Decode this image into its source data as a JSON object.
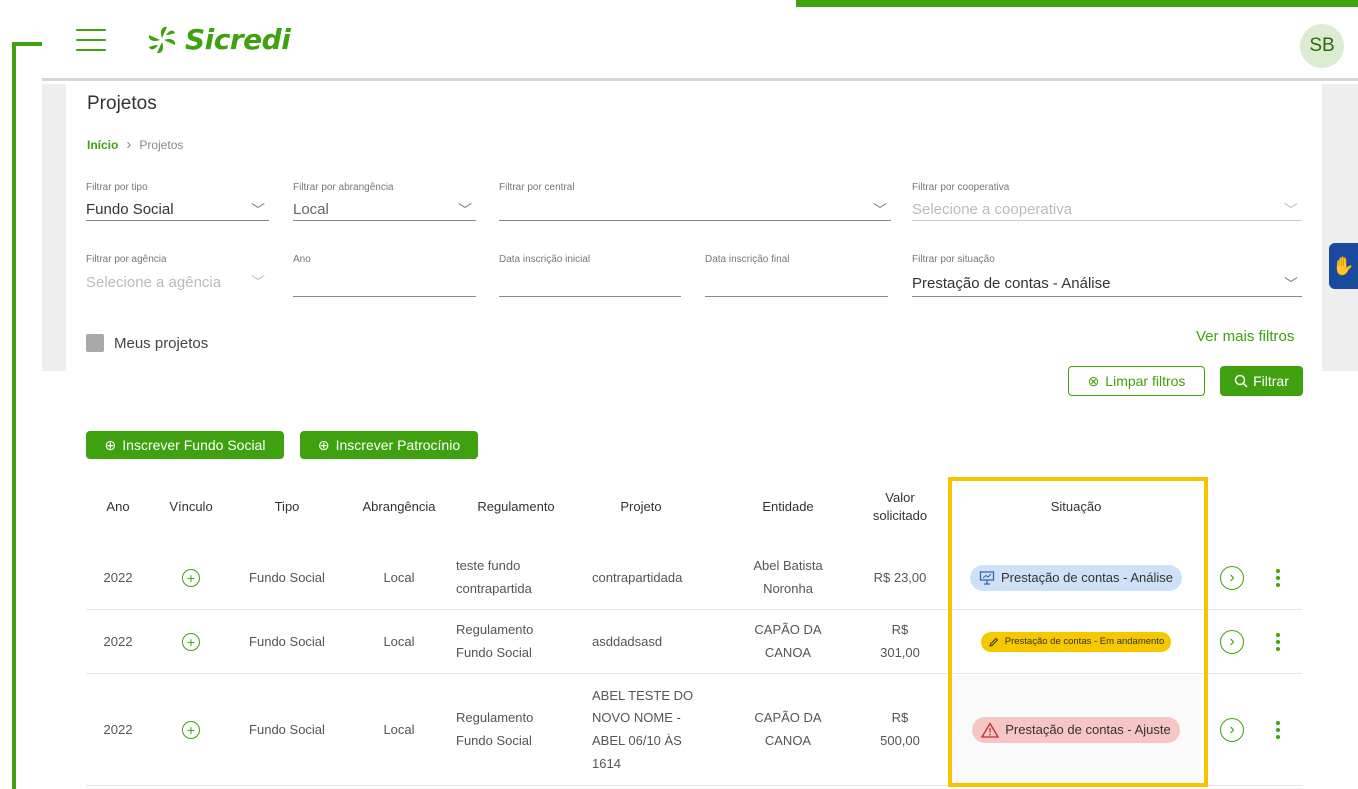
{
  "header": {
    "brand": "Sicredi",
    "user_initials": "SB"
  },
  "page": {
    "title": "Projetos",
    "breadcrumb": {
      "home": "Início",
      "current": "Projetos"
    }
  },
  "filters": {
    "tipo": {
      "label": "Filtrar por tipo",
      "value": "Fundo Social"
    },
    "abrangencia": {
      "label": "Filtrar por abrangência",
      "value": "Local"
    },
    "central": {
      "label": "Filtrar por central",
      "value": ""
    },
    "cooperativa": {
      "label": "Filtrar por cooperativa",
      "placeholder": "Selecione a cooperativa"
    },
    "agencia": {
      "label": "Filtrar por agência",
      "placeholder": "Selecione a agência"
    },
    "ano": {
      "label": "Ano",
      "value": ""
    },
    "data_inicial": {
      "label": "Data inscrição inicial",
      "value": ""
    },
    "data_final": {
      "label": "Data inscrição final",
      "value": ""
    },
    "situacao": {
      "label": "Filtrar por situação",
      "value": "Prestação de contas - Análise"
    }
  },
  "meus_projetos": "Meus projetos",
  "ver_mais_filtros": "Ver mais filtros",
  "buttons": {
    "limpar": "Limpar filtros",
    "filtrar": "Filtrar",
    "inscrever_fundo": "Inscrever Fundo Social",
    "inscrever_patrocinio": "Inscrever Patrocínio"
  },
  "table": {
    "headers": {
      "ano": "Ano",
      "vinculo": "Vínculo",
      "tipo": "Tipo",
      "abrangencia": "Abrangência",
      "regulamento": "Regulamento",
      "projeto": "Projeto",
      "entidade": "Entidade",
      "valor_1": "Valor",
      "valor_2": "solicitado",
      "situacao": "Situação"
    },
    "rows": [
      {
        "ano": "2022",
        "tipo": "Fundo Social",
        "abrangencia": "Local",
        "regulamento": [
          "teste fundo",
          "contrapartida"
        ],
        "projeto": [
          "contrapartidada"
        ],
        "entidade": [
          "Abel Batista",
          "Noronha"
        ],
        "valor": [
          "R$ 23,00"
        ],
        "situacao": "Prestação de contas - Análise"
      },
      {
        "ano": "2022",
        "tipo": "Fundo Social",
        "abrangencia": "Local",
        "regulamento": [
          "Regulamento",
          "Fundo Social"
        ],
        "projeto": [
          "asddadsasd"
        ],
        "entidade": [
          "CAPÃO DA",
          "CANOA"
        ],
        "valor": [
          "R$",
          "301,00"
        ],
        "situacao": "Prestação de contas - Em andamento"
      },
      {
        "ano": "2022",
        "tipo": "Fundo Social",
        "abrangencia": "Local",
        "regulamento": [
          "Regulamento",
          "Fundo Social"
        ],
        "projeto": [
          "ABEL TESTE DO",
          "NOVO NOME -",
          "ABEL 06/10 ÀS",
          "1614"
        ],
        "entidade": [
          "CAPÃO DA",
          "CANOA"
        ],
        "valor": [
          "R$",
          "500,00"
        ],
        "situacao": "Prestação de contas - Ajuste"
      }
    ]
  },
  "colors": {
    "brand_green": "#3fa110",
    "badge_blue": "#cfe1f7",
    "badge_yellow": "#f6c800",
    "badge_red": "#f6c6c6",
    "highlight": "#f5c300"
  }
}
